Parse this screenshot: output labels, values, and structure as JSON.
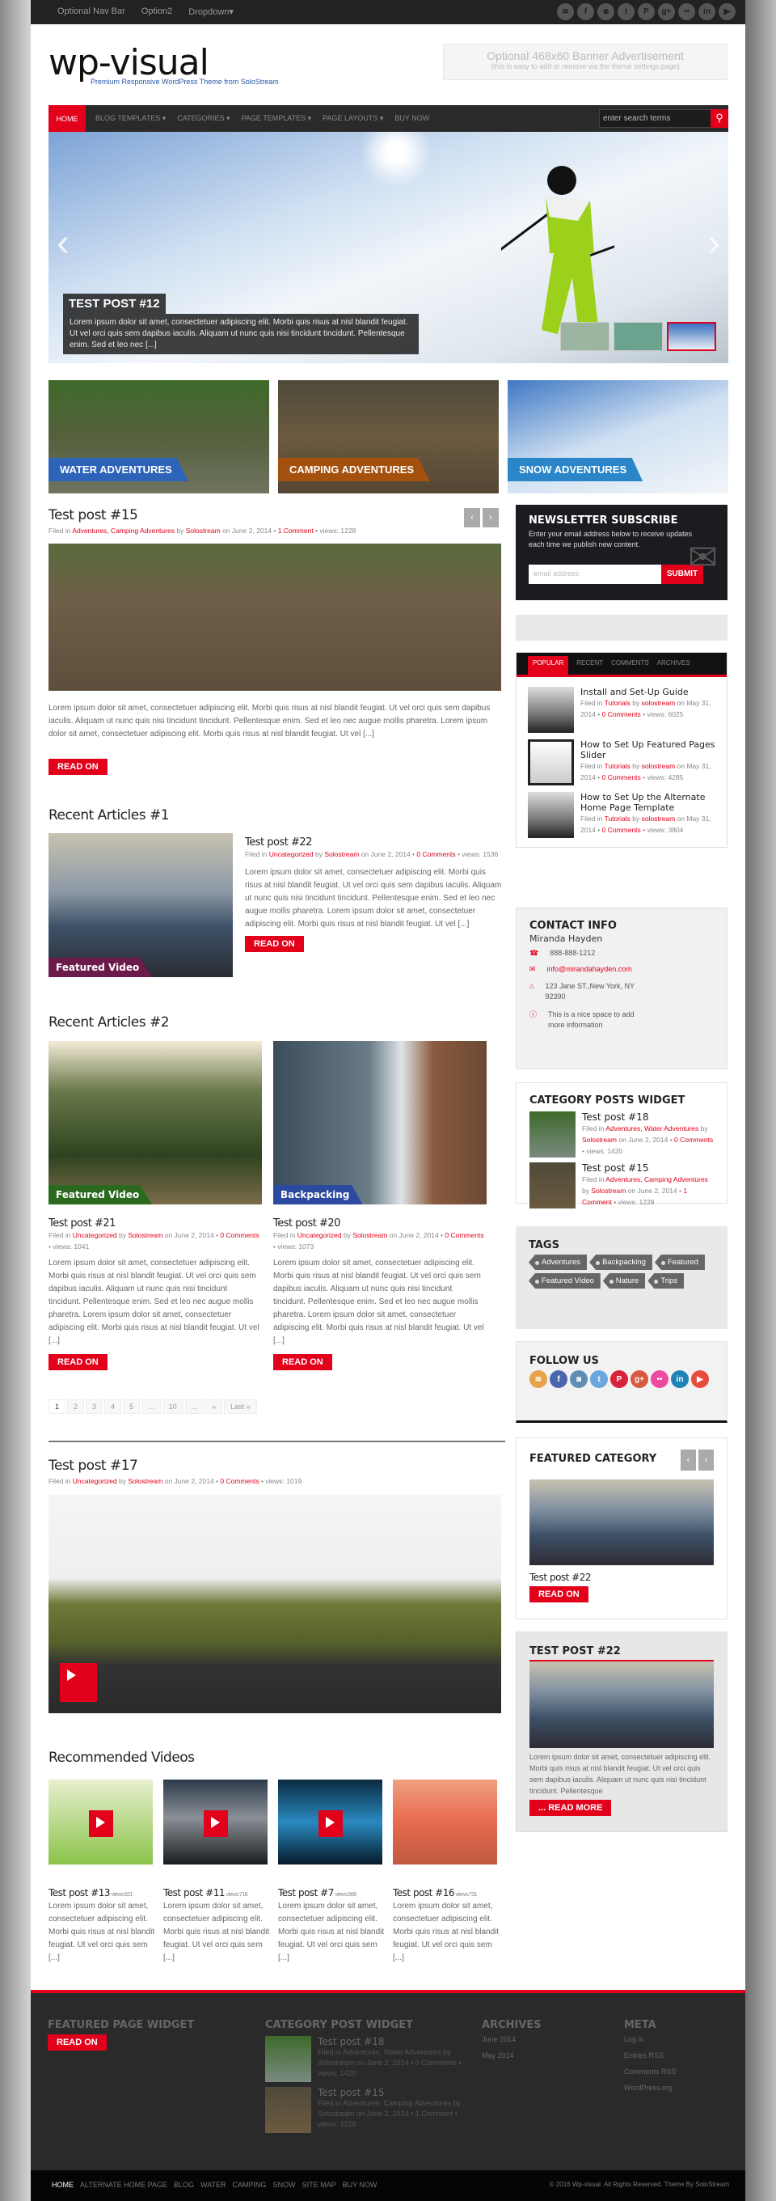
{
  "topbar": {
    "nav": [
      "Optional Nav Bar",
      "Option2",
      "Dropdown▾"
    ],
    "social": [
      {
        "name": "rss-icon",
        "glyph": "≋"
      },
      {
        "name": "facebook-icon",
        "glyph": "f"
      },
      {
        "name": "instagram-icon",
        "glyph": "◙"
      },
      {
        "name": "twitter-icon",
        "glyph": "t"
      },
      {
        "name": "pinterest-icon",
        "glyph": "P"
      },
      {
        "name": "google-plus-icon",
        "glyph": "g+"
      },
      {
        "name": "flickr-icon",
        "glyph": "••"
      },
      {
        "name": "linkedin-icon",
        "glyph": "in"
      },
      {
        "name": "youtube-icon",
        "glyph": "▶"
      }
    ]
  },
  "header": {
    "logo": "wp-visual",
    "tagline": "Premium Responsive WordPress Theme from SoloStream",
    "banner_title": "Optional 468x60 Banner Advertisement",
    "banner_sub": "(this is easy to add or remove via the theme settings page)"
  },
  "mainnav": {
    "home": "HOME",
    "items": [
      "BLOG TEMPLATES ▾",
      "CATEGORIES ▾",
      "PAGE TEMPLATES ▾",
      "PAGE LAYOUTS ▾",
      "BUY NOW"
    ],
    "search_placeholder": "enter search terms"
  },
  "slider": {
    "title": "TEST POST #12",
    "excerpt": "Lorem ipsum dolor sit amet, consectetuer adipiscing elit. Morbi quis risus at nisl blandit feugiat. Ut vel orci quis sem dapibus iaculis. Aliquam ut nunc quis nisi tincidunt tincidunt. Pellentesque enim. Sed et leo nec [...]",
    "thumbs": 3,
    "active_thumb": 3
  },
  "categories": [
    {
      "label": "WATER ADVENTURES",
      "color": "#2d63b8"
    },
    {
      "label": "CAMPING ADVENTURES",
      "color": "#a4510e"
    },
    {
      "label": "SNOW ADVENTURES",
      "color": "#2a86c8"
    }
  ],
  "featured_post": {
    "title": "Test post #15",
    "meta": {
      "filed": "Filed in",
      "cats": "Adventures, Camping Adventures",
      "by": "by",
      "author": "Solostream",
      "on": "on June 2, 2014 •",
      "comments": "1 Comment",
      "views": "• views: 1228"
    },
    "excerpt": "Lorem ipsum dolor sit amet, consectetuer adipiscing elit. Morbi quis risus at nisl blandit feugiat. Ut vel orci quis sem dapibus iaculis. Aliquam ut nunc quis nisi tincidunt tincidunt. Pellentesque enim. Sed et leo nec augue mollis pharetra. Lorem ipsum dolor sit amet, consectetuer adipiscing elit. Morbi quis risus at nisl blandit feugiat. Ut vel [...]",
    "button": "READ ON"
  },
  "recent1": {
    "heading": "Recent Articles #1",
    "badge": "Featured Video",
    "title": "Test post #22",
    "meta": {
      "filed": "Filed in",
      "cats": "Uncategorized",
      "by": "by",
      "author": "Solostream",
      "on": "on June 2, 2014 •",
      "comments": "0 Comments",
      "views": "• views: 1536"
    },
    "excerpt": "Lorem ipsum dolor sit amet, consectetuer adipiscing elit. Morbi quis risus at nisl blandit feugiat. Ut vel orci quis sem dapibus iaculis. Aliquam ut nunc quis nisi tincidunt tincidunt. Pellentesque enim. Sed et leo nec augue mollis pharetra. Lorem ipsum dolor sit amet, consectetuer adipiscing elit. Morbi quis risus at nisl blandit feugiat. Ut vel [...]",
    "button": "READ ON"
  },
  "recent2": {
    "heading": "Recent Articles #2",
    "posts": [
      {
        "badge": "Featured Video",
        "title": "Test post #21",
        "meta": {
          "filed": "Filed in",
          "cats": "Uncategorized",
          "by": "by",
          "author": "Solostream",
          "on": "on June 2, 2014 •",
          "comments": "0 Comments",
          "views": "• views: 1041"
        }
      },
      {
        "badge": "Backpacking",
        "title": "Test post #20",
        "meta": {
          "filed": "Filed in",
          "cats": "Uncategorized",
          "by": "by",
          "author": "Solostream",
          "on": "on June 2, 2014 •",
          "comments": "0 Comments",
          "views": "• views: 1073"
        }
      }
    ],
    "excerpt": "Lorem ipsum dolor sit amet, consectetuer adipiscing elit. Morbi quis risus at nisl blandit feugiat. Ut vel orci quis sem dapibus iaculis. Aliquam ut nunc quis nisi tincidunt tincidunt. Pellentesque enim. Sed et leo nec augue mollis pharetra. Lorem ipsum dolor sit amet, consectetuer adipiscing elit. Morbi quis risus at nisl blandit feugiat. Ut vel [...]",
    "button": "READ ON",
    "pager": [
      "1",
      "2",
      "3",
      "4",
      "5",
      "...",
      "10",
      "...",
      "»",
      "Last »"
    ]
  },
  "post17": {
    "title": "Test post #17",
    "meta": {
      "filed": "Filed in",
      "cats": "Uncategorized",
      "by": "by",
      "author": "Solostream",
      "on": "on June 2, 2014 •",
      "comments": "0 Comments",
      "views": "• views: 1019"
    }
  },
  "videos": {
    "heading": "Recommended Videos",
    "items": [
      {
        "title": "Test post #13",
        "views": "views:821"
      },
      {
        "title": "Test post #11",
        "views": "views:718"
      },
      {
        "title": "Test post #7",
        "views": "views:566"
      },
      {
        "title": "Test post #16",
        "views": "views:731"
      }
    ],
    "excerpt": "Lorem ipsum dolor sit amet, consectetuer adipiscing elit. Morbi quis risus at nisl blandit feugiat. Ut vel orci quis sem [...]"
  },
  "sidebar": {
    "newsletter": {
      "title": "NEWSLETTER SUBSCRIBE",
      "text": "Enter your email address below to receive updates each time we publish new content.",
      "placeholder": "email address",
      "button": "SUBMIT"
    },
    "tabs": [
      "POPULAR",
      "RECENT",
      "COMMENTS",
      "ARCHIVES"
    ],
    "popular": [
      {
        "title": "Install and Set-Up Guide",
        "cat": "Tutorials",
        "author": "solostream",
        "date": "on May 31, 2014 •",
        "comments": "0 Comments",
        "views": "• views: 6025"
      },
      {
        "title": "How to Set Up Featured Pages Slider",
        "cat": "Tutorials",
        "author": "solostream",
        "date": "on May 31, 2014 •",
        "comments": "0 Comments",
        "views": "• views: 4285"
      },
      {
        "title": "How to Set Up the Alternate Home Page Template",
        "cat": "Tutorials",
        "author": "solostream",
        "date": "on May 31, 2014 •",
        "comments": "0 Comments",
        "views": "• views: 3804"
      }
    ],
    "contact": {
      "title": "CONTACT INFO",
      "name": "Miranda Hayden",
      "phone": "888-888-1212",
      "email": "info@mirandahayden.com",
      "address": "123 Jane ST.,New York, NY 92390",
      "info": "This is a nice space to add more information"
    },
    "catposts": {
      "title": "CATEGORY POSTS WIDGET",
      "items": [
        {
          "title": "Test post #18",
          "cats": "Adventures, Water Adventures",
          "author": "Solostream",
          "date": "on June 2, 2014 •",
          "comments": "0 Comments",
          "views": "• views: 1420"
        },
        {
          "title": "Test post #15",
          "cats": "Adventures, Camping Adventures",
          "author": "Solostream",
          "date": "on June 2, 2014 •",
          "comments": "1 Comment",
          "views": "• views: 1228"
        }
      ]
    },
    "tags": {
      "title": "TAGS",
      "items": [
        "Adventures",
        "Backpacking",
        "Featured",
        "Featured Video",
        "Nature",
        "Trips"
      ]
    },
    "follow": {
      "title": "FOLLOW US",
      "icons": [
        {
          "name": "rss-icon",
          "glyph": "≋",
          "color": "#e8a24a"
        },
        {
          "name": "facebook-icon",
          "glyph": "f",
          "color": "#4a67ad"
        },
        {
          "name": "instagram-icon",
          "glyph": "◙",
          "color": "#5f8db5"
        },
        {
          "name": "twitter-icon",
          "glyph": "t",
          "color": "#6aa7de"
        },
        {
          "name": "pinterest-icon",
          "glyph": "P",
          "color": "#d6233b"
        },
        {
          "name": "google-plus-icon",
          "glyph": "g+",
          "color": "#d8593f"
        },
        {
          "name": "flickr-icon",
          "glyph": "••",
          "color": "#ec4aa1"
        },
        {
          "name": "linkedin-icon",
          "glyph": "in",
          "color": "#1f83b7"
        },
        {
          "name": "youtube-icon",
          "glyph": "▶",
          "color": "#e74c3c"
        }
      ]
    },
    "featcat": {
      "title": "FEATURED CATEGORY",
      "post": "Test post #22",
      "button": "READ ON"
    },
    "tp22": {
      "title": "TEST POST #22",
      "excerpt": "Lorem ipsum dolor sit amet, consectetuer adipiscing elit. Morbi quis risus at nisl blandit feugiat. Ut vel orci quis sem dapibus iaculis. Aliquam ut nunc quis nisi tincidunt tincidunt. Pellentesque",
      "button": "... READ MORE"
    }
  },
  "footer": {
    "featured_title": "FEATURED PAGE WIDGET",
    "featured_button": "READ ON",
    "catpost_title": "CATEGORY POST WIDGET",
    "catposts": [
      {
        "title": "Test post #18",
        "meta": "Filed in Adventures, Water Adventures by Solostream on June 2, 2014 • 0 Comments • views: 1420"
      },
      {
        "title": "Test post #15",
        "meta": "Filed in Adventures, Camping Adventures by Solostream on June 2, 2014 • 1 Comment • views: 1228"
      }
    ],
    "archives_title": "ARCHIVES",
    "archives": [
      "June 2014",
      "May 2014"
    ],
    "meta_title": "META",
    "meta": [
      "Log in",
      "Entries RSS",
      "Comments RSS",
      "WordPress.org"
    ]
  },
  "bottombar": {
    "nav": [
      "HOME",
      "ALTERNATE HOME PAGE",
      "BLOG",
      "WATER",
      "CAMPING",
      "SNOW",
      "SITE MAP",
      "BUY NOW"
    ],
    "copyright": "© 2016 Wp-visual. All Rights Reserved. Theme By SoloStream"
  }
}
